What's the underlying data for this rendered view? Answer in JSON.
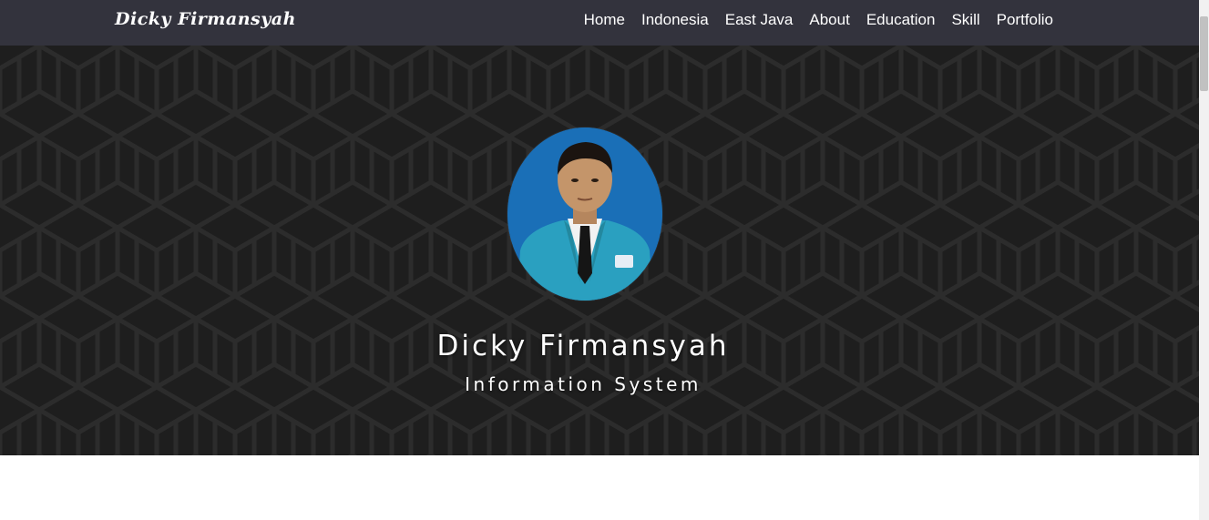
{
  "navbar": {
    "brand": "Dicky Firmansyah",
    "links": [
      {
        "label": "Home"
      },
      {
        "label": "Indonesia"
      },
      {
        "label": "East Java"
      },
      {
        "label": "About"
      },
      {
        "label": "Education"
      },
      {
        "label": "Skill"
      },
      {
        "label": "Portfolio"
      }
    ]
  },
  "hero": {
    "name": "Dicky Firmansyah",
    "subtitle": "Information System",
    "avatar_icon": "profile-photo"
  },
  "colors": {
    "navbar_bg": "#33333d",
    "hero_bg": "#1e1e1e",
    "avatar_bg": "#1a6fb7",
    "jacket": "#2aa0c0"
  }
}
